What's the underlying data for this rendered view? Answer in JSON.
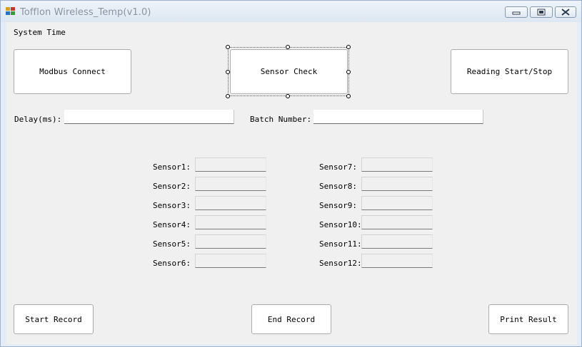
{
  "window": {
    "title": "Tofflon Wireless_Temp(v1.0)",
    "controls": [
      "minimize-icon",
      "maximize-icon",
      "close-icon"
    ]
  },
  "form": {
    "system_time_label": "System Time",
    "buttons": {
      "modbus_connect": "Modbus Connect",
      "sensor_check": "Sensor Check",
      "reading_start_stop": "Reading Start/Stop",
      "start_record": "Start Record",
      "end_record": "End Record",
      "print_result": "Print Result"
    },
    "delay": {
      "label": "Delay(ms):",
      "value": ""
    },
    "batch": {
      "label": "Batch Number:",
      "value": ""
    },
    "sensors": [
      {
        "label": "Sensor1:",
        "value": ""
      },
      {
        "label": "Sensor2:",
        "value": ""
      },
      {
        "label": "Sensor3:",
        "value": ""
      },
      {
        "label": "Sensor4:",
        "value": ""
      },
      {
        "label": "Sensor5:",
        "value": ""
      },
      {
        "label": "Sensor6:",
        "value": ""
      },
      {
        "label": "Sensor7:",
        "value": ""
      },
      {
        "label": "Sensor8:",
        "value": ""
      },
      {
        "label": "Sensor9:",
        "value": ""
      },
      {
        "label": "Sensor10:",
        "value": ""
      },
      {
        "label": "Sensor11:",
        "value": ""
      },
      {
        "label": "Sensor12:",
        "value": ""
      }
    ]
  },
  "colors": {
    "form_background": "#f0f0f0",
    "title_text": "#8a94a0",
    "button_border": "#adadad"
  }
}
